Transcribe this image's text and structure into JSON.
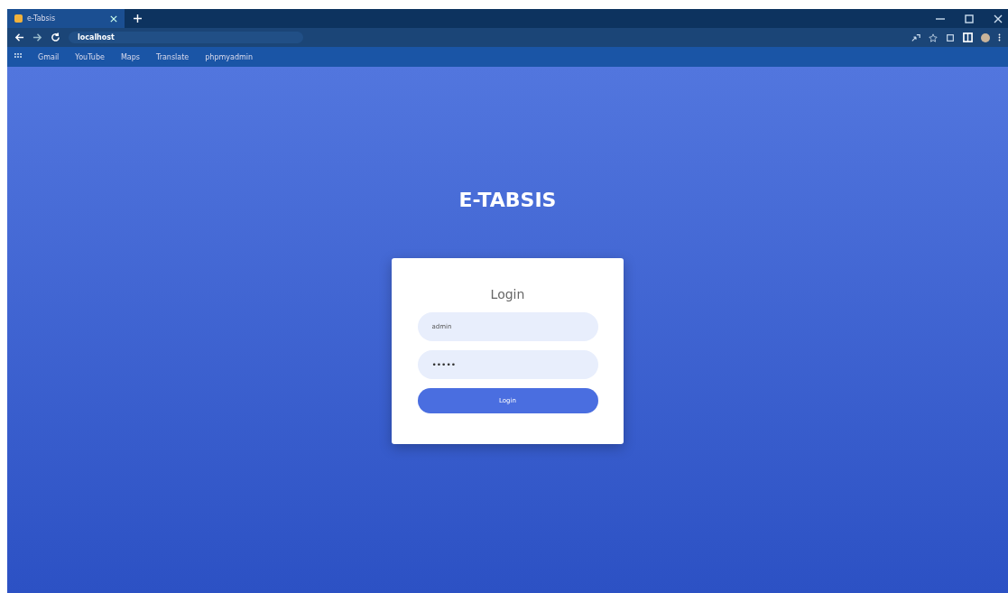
{
  "browser": {
    "tab_title": "e-Tabsis",
    "address": "localhost",
    "bookmarks": [
      "Gmail",
      "YouTube",
      "Maps",
      "Translate",
      "phpmyadmin"
    ]
  },
  "page": {
    "app_title": "E-TABSIS",
    "login": {
      "heading": "Login",
      "username": {
        "value": "admin"
      },
      "password": {
        "value": "•••••"
      },
      "button": "Login"
    }
  }
}
